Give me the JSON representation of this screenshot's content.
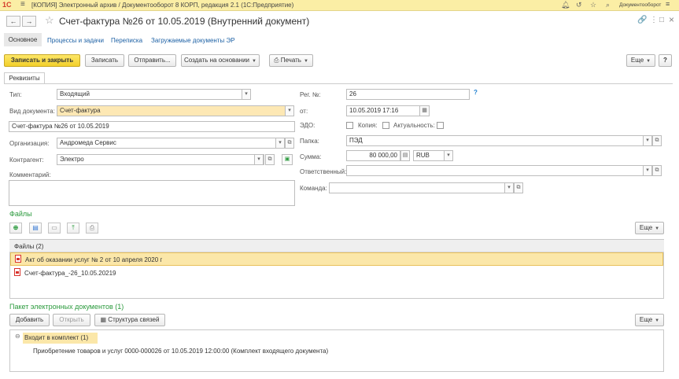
{
  "titlebar": {
    "logo": "1С",
    "title": "[КОПИЯ] Электронный архив / Документооборот 8 КОРП, редакция 2.1  (1С:Предприятие)",
    "user": "Документооборот",
    "icons": [
      "bell-icon",
      "history-icon",
      "star-icon",
      "info-icon",
      "search-icon",
      "menu-icon"
    ]
  },
  "header": {
    "back": "←",
    "forward": "→",
    "title": "Счет-фактура №26 от 10.05.2019 (Внутренний документ)",
    "link_icon": "🔗",
    "more_icon": "⋮",
    "maximize_icon": "□",
    "close_icon": "×"
  },
  "tabs": {
    "main": "Основное",
    "links": [
      "Процессы и задачи",
      "Переписка",
      "Загружаемые документы ЭР"
    ]
  },
  "toolbar": {
    "save_close": "Записать и закрыть",
    "save": "Записать",
    "send": "Отправить...",
    "create_based": "Создать на основании",
    "print": "Печать",
    "more": "Еще",
    "help": "?"
  },
  "section_tab": "Реквизиты",
  "form": {
    "type_label": "Тип:",
    "type_value": "Входящий",
    "doctype_label": "Вид документа:",
    "doctype_value": "Счет-фактура",
    "name_value": "Счет-фактура №26 от 10.05.2019",
    "org_label": "Организация:",
    "org_value": "Андромеда Сервис",
    "contractor_label": "Контрагент:",
    "contractor_value": "Электро",
    "comment_label": "Комментарий:",
    "regnum_label": "Рег. №:",
    "regnum_value": "26",
    "date_label": "от:",
    "date_value": "10.05.2019 17:16",
    "edo_label": "ЭДО:",
    "copy_label": "Копия:",
    "actual_label": "Актуальность:",
    "folder_label": "Папка:",
    "folder_value": "ПЭД",
    "sum_label": "Сумма:",
    "sum_value": "80 000,00",
    "currency_value": "RUB",
    "responsible_label": "Ответственный:",
    "responsible_value": "",
    "team_label": "Команда:",
    "team_value": ""
  },
  "files": {
    "title": "Файлы",
    "more": "Еще",
    "header": "Файлы (2)",
    "rows": [
      "Акт об оказании услуг № 2 от 10 апреля 2020 г",
      "Счет-фактура_-26_10.05.20219"
    ]
  },
  "package": {
    "title": "Пакет электронных документов (1)",
    "add": "Добавить",
    "open": "Открыть",
    "structure": "Структура связей",
    "more": "Еще",
    "group": "Входит в комплект (1)",
    "item": "Приобретение товаров и услуг 0000-000026 от 10.05.2019 12:00:00 (Комплект входящего документа)"
  }
}
